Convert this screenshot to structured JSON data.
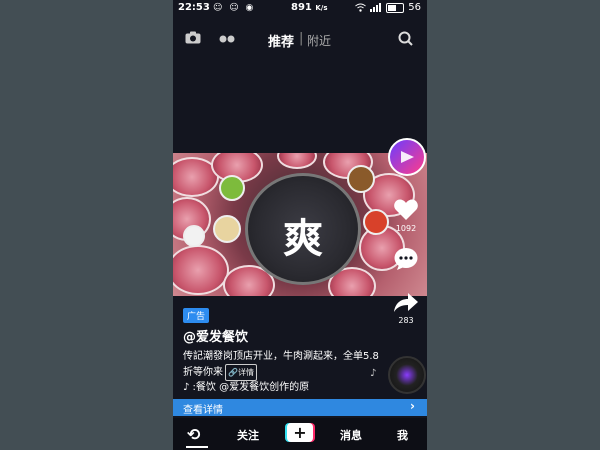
{
  "status_bar": {
    "time": "22:53",
    "network": "891",
    "network_unit": "K/s",
    "battery": "56",
    "battery_level": 0.56
  },
  "top_nav": {
    "tab_recommend": "推荐",
    "separator": "|",
    "tab_nearby": "附近"
  },
  "video": {
    "logo_glyph": "爽"
  },
  "right_bar": {
    "like_count": "1092",
    "share_count": "283"
  },
  "post": {
    "ad_label": "广告",
    "username": "@爱发餐饮",
    "description": "传記潮發岗顶店开业，牛肉涮起来，全单5.8折等你来",
    "detail_tag": "🔗详情",
    "music_text": "♪ :餐饮   @爱发餐饮创作的原"
  },
  "cta": {
    "label": "查看详情",
    "chevron": "›"
  },
  "bottom_nav": {
    "follow": "关注",
    "plus": "+",
    "messages": "消息",
    "me": "我"
  },
  "colors": {
    "cta": "#2f88e0",
    "background": "#13151f"
  }
}
